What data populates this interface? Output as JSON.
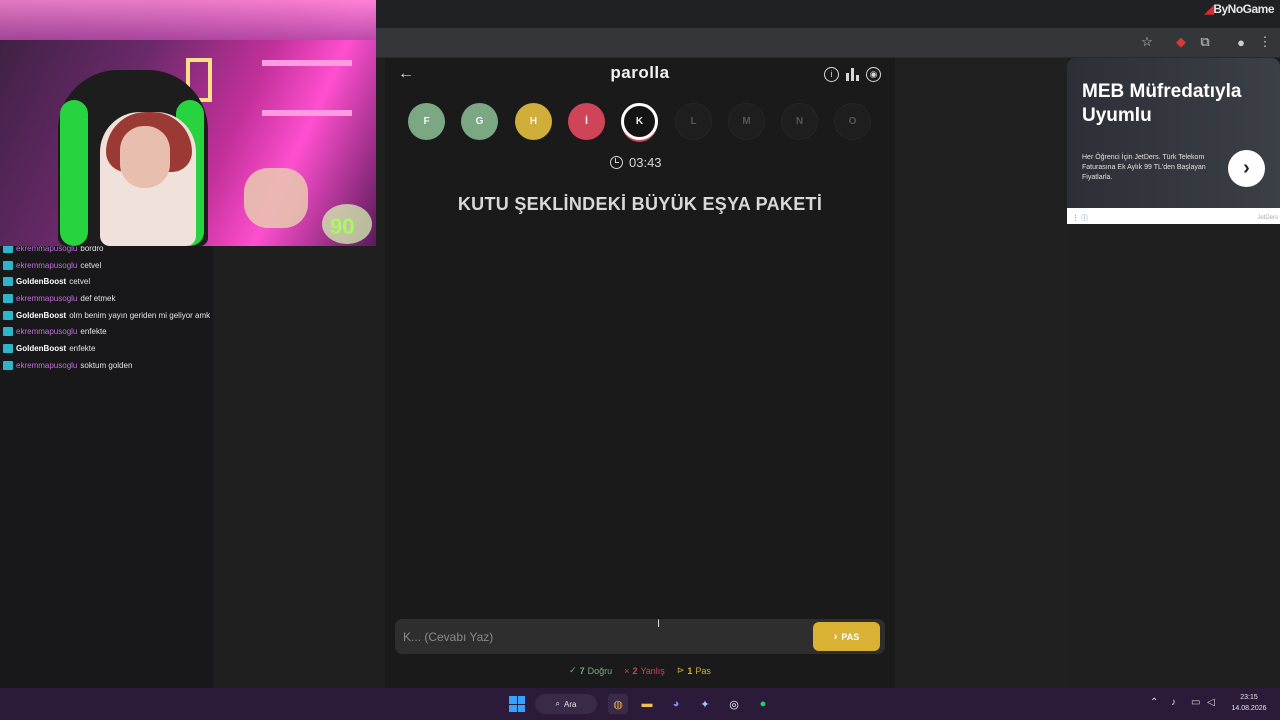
{
  "browser": {
    "brand_text": "ByNoGame"
  },
  "webcam": {
    "badge": "90"
  },
  "chat": [
    {
      "user": "ekremmapusoglu",
      "color": "#c56bdb",
      "msg": "bordro"
    },
    {
      "user": "ekremmapusoglu",
      "color": "#c56bdb",
      "msg": "cetvel"
    },
    {
      "user": "GoldenBoost",
      "color": "#ffffff",
      "msg": "cetvel"
    },
    {
      "user": "ekremmapusoglu",
      "color": "#c56bdb",
      "msg": "def etmek"
    },
    {
      "user": "GoldenBoost",
      "color": "#ffffff",
      "msg": "olm benim yayın geriden mi geliyor amk"
    },
    {
      "user": "ekremmapusoglu",
      "color": "#c56bdb",
      "msg": "enfekte"
    },
    {
      "user": "GoldenBoost",
      "color": "#ffffff",
      "msg": "enfekte"
    },
    {
      "user": "ekremmapusoglu",
      "color": "#c56bdb",
      "msg": "soktum golden"
    }
  ],
  "game": {
    "title": "parolla",
    "letters": [
      {
        "char": "F",
        "state": "correct"
      },
      {
        "char": "G",
        "state": "correct"
      },
      {
        "char": "H",
        "state": "pass"
      },
      {
        "char": "İ",
        "state": "wrong"
      },
      {
        "char": "K",
        "state": "current"
      },
      {
        "char": "L",
        "state": "pending"
      },
      {
        "char": "M",
        "state": "pending"
      },
      {
        "char": "N",
        "state": "pending"
      },
      {
        "char": "O",
        "state": "pending"
      }
    ],
    "timer": "03:43",
    "question": "KUTU ŞEKLİNDEKİ BÜYÜK EŞYA PAKETİ",
    "answer_placeholder": "K... (Cevabı Yaz)",
    "pass_label": "PAS",
    "stats": {
      "correct_count": "7",
      "correct_label": "Doğru",
      "wrong_count": "2",
      "wrong_label": "Yanlış",
      "pass_count": "1",
      "pass_label": "Pas"
    }
  },
  "ad": {
    "title": "MEB Müfredatıyla Uyumlu",
    "text": "Her Öğrenci İçin JetDers. Türk Telekom Faturasına Ek Aylık 99 TL'den Başlayan Fiyatlarla.",
    "source": "JetDers"
  },
  "taskbar": {
    "search_label": "Ara",
    "time": "23:15",
    "date": "14.08.2026"
  }
}
